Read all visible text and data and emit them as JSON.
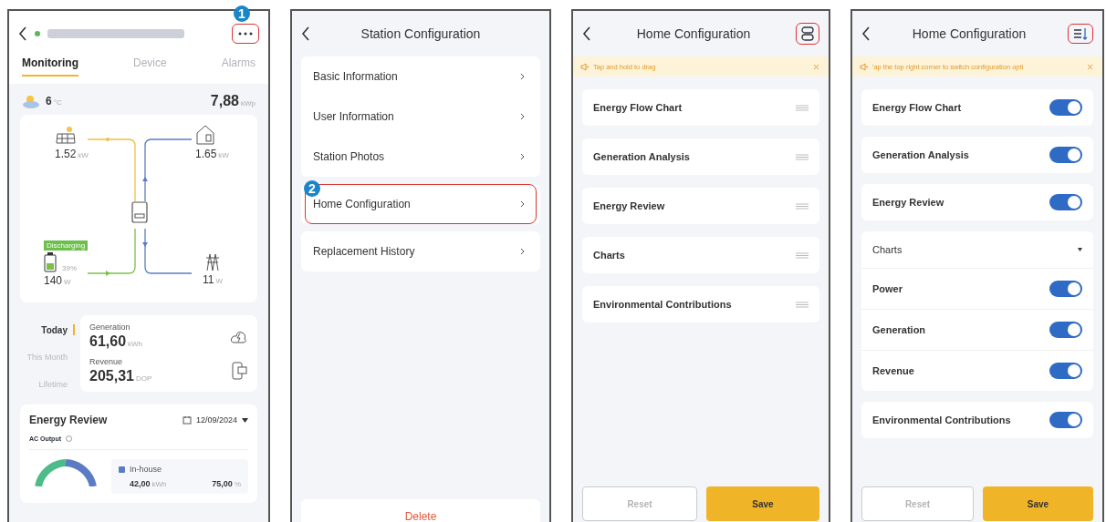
{
  "monitoring_screen": {
    "callout": "1",
    "menu_highlighted": true,
    "tabs": [
      {
        "label": "Monitoring",
        "selected": true
      },
      {
        "label": "Device",
        "selected": false
      },
      {
        "label": "Alarms",
        "selected": false
      }
    ],
    "weather": {
      "temperature": "6",
      "unit": "°C"
    },
    "capacity": {
      "value": "7,88",
      "unit": "kWp"
    },
    "flow": {
      "solar": {
        "value": "1.52",
        "unit": "kW"
      },
      "home": {
        "value": "1.65",
        "unit": "kW"
      },
      "battery": {
        "status": "Discharging",
        "charge": "39%",
        "value": "140",
        "unit": "W"
      },
      "grid": {
        "value": "11",
        "unit": "W"
      }
    },
    "periods": [
      {
        "label": "Today",
        "selected": true
      },
      {
        "label": "This Month",
        "selected": false
      },
      {
        "label": "Lifetime",
        "selected": false
      }
    ],
    "stats": [
      {
        "kind": "generation",
        "label": "Generation",
        "value": "61,60",
        "unit": "kWh"
      },
      {
        "kind": "revenue",
        "label": "Revenue",
        "value": "205,31",
        "unit": "DOP"
      }
    ],
    "energy_review": {
      "title": "Energy Review",
      "date": "12/09/2024",
      "series_label": "AC Output",
      "legend": [
        {
          "label": "In-house",
          "value": "42,00",
          "unit": "kWh",
          "share": "75,00",
          "share_unit": "%",
          "color": "#5b7cc4"
        }
      ]
    }
  },
  "station_screen": {
    "title": "Station Configuration",
    "callout": "2",
    "groups": [
      {
        "items": [
          {
            "label": "Basic Information",
            "highlighted": false
          },
          {
            "label": "User Information",
            "highlighted": false
          },
          {
            "label": "Station Photos",
            "highlighted": false
          }
        ]
      },
      {
        "items": [
          {
            "label": "Home Configuration",
            "highlighted": true
          }
        ]
      },
      {
        "items": [
          {
            "label": "Replacement History",
            "highlighted": false
          }
        ]
      }
    ],
    "delete_label": "Delete"
  },
  "drag_screen": {
    "title": "Home Configuration",
    "action_highlighted": true,
    "hint": "Tap and hold to drag",
    "items": [
      {
        "label": "Energy Flow Chart"
      },
      {
        "label": "Generation Analysis"
      },
      {
        "label": "Energy Review"
      },
      {
        "label": "Charts"
      },
      {
        "label": "Environmental Contributions"
      }
    ],
    "reset_label": "Reset",
    "reset_disabled": true,
    "save_label": "Save"
  },
  "toggle_screen": {
    "title": "Home Configuration",
    "action_highlighted": true,
    "hint": "'ap the top right corner to switch configuration opti",
    "groups": [
      {
        "kind": "toggle",
        "label": "Energy Flow Chart",
        "on": true
      },
      {
        "kind": "toggle",
        "label": "Generation Analysis",
        "on": true
      },
      {
        "kind": "toggle",
        "label": "Energy Review",
        "on": true
      },
      {
        "kind": "expandable",
        "label": "Charts",
        "expanded": true,
        "children": [
          {
            "label": "Power",
            "on": true
          },
          {
            "label": "Generation",
            "on": true
          },
          {
            "label": "Revenue",
            "on": true
          }
        ]
      },
      {
        "kind": "toggle",
        "label": "Environmental Contributions",
        "on": true
      }
    ],
    "reset_label": "Reset",
    "reset_disabled": true,
    "save_label": "Save"
  }
}
